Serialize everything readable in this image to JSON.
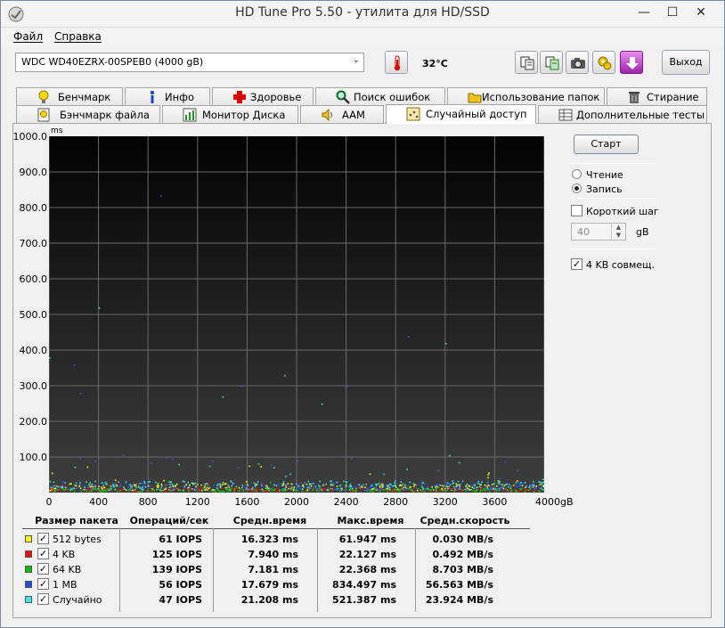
{
  "window": {
    "title": "HD Tune Pro 5.50 - утилита для HD/SSD"
  },
  "menu": [
    {
      "label": "Файл"
    },
    {
      "label": "Справка"
    }
  ],
  "toolbar": {
    "drive": "WDC WD40EZRX-00SPEB0 (4000 gB)",
    "temperature": "32°C",
    "exit_label": "Выход"
  },
  "tabs_top": [
    {
      "label": "Бенчмарк"
    },
    {
      "label": "Инфо"
    },
    {
      "label": "Здоровье"
    },
    {
      "label": "Поиск ошибок"
    },
    {
      "label": "Использование папок"
    },
    {
      "label": "Стирание"
    }
  ],
  "tabs_bottom": [
    {
      "label": "Бэнчмарк файла"
    },
    {
      "label": "Монитор Диска"
    },
    {
      "label": "AAM"
    },
    {
      "label": "Случайный доступ"
    },
    {
      "label": "Дополнительные  тесты"
    }
  ],
  "active_tab": "Случайный доступ",
  "chart": {
    "unit": "ms",
    "y_ticks": [
      "1000.0",
      "900.0",
      "800.0",
      "700.0",
      "600.0",
      "500.0",
      "400.0",
      "300.0",
      "200.0",
      "100.0"
    ],
    "x_ticks": [
      "0",
      "400",
      "800",
      "1200",
      "1600",
      "2000",
      "2400",
      "2800",
      "3200",
      "3600",
      "4000gB"
    ]
  },
  "chart_data": {
    "type": "scatter",
    "ylabel": "ms",
    "ylim": [
      0,
      1000
    ],
    "xlim": [
      0,
      4000
    ],
    "grid": true,
    "x_ticks": [
      0,
      400,
      800,
      1200,
      1600,
      2000,
      2400,
      2800,
      3200,
      3600,
      4000
    ],
    "series": [
      {
        "name": "512 bytes",
        "color": "#ffff00",
        "avg_ms": 16.323,
        "max_ms": 61.947
      },
      {
        "name": "4 KB",
        "color": "#ff0000",
        "avg_ms": 7.94,
        "max_ms": 22.127
      },
      {
        "name": "64 KB",
        "color": "#00cc00",
        "avg_ms": 7.181,
        "max_ms": 22.368
      },
      {
        "name": "1 MB",
        "color": "#2060ff",
        "avg_ms": 17.679,
        "max_ms": 834.497
      },
      {
        "name": "Случайно",
        "color": "#40e0e0",
        "avg_ms": 21.208,
        "max_ms": 521.387
      }
    ],
    "outliers": [
      {
        "x": 900,
        "y": 835
      },
      {
        "x": 400,
        "y": 520
      },
      {
        "x": 2900,
        "y": 440
      },
      {
        "x": 3200,
        "y": 420
      },
      {
        "x": 200,
        "y": 360
      },
      {
        "x": 1900,
        "y": 330
      },
      {
        "x": 2400,
        "y": 300
      },
      {
        "x": 0,
        "y": 380
      },
      {
        "x": 1550,
        "y": 300
      },
      {
        "x": 1400,
        "y": 270
      },
      {
        "x": 250,
        "y": 280
      },
      {
        "x": 2200,
        "y": 250
      }
    ]
  },
  "side": {
    "start_label": "Старт",
    "read_label": "Чтение",
    "write_label": "Запись",
    "short_step_label": "Короткий шаг",
    "step_value": "40",
    "step_unit": "gB",
    "align_label": "4 KB совмещ."
  },
  "table": {
    "headers": [
      "Размер пакета",
      "Операций/сек",
      "Средн.время",
      "Макс.время",
      "Средн.скорость"
    ],
    "rows": [
      {
        "name": "512 bytes",
        "color": "#ffff00",
        "iops": "61 IOPS",
        "avg": "16.323 ms",
        "max": "61.947 ms",
        "speed": "0.030 MB/s"
      },
      {
        "name": "4 KB",
        "color": "#ff0000",
        "iops": "125 IOPS",
        "avg": "7.940 ms",
        "max": "22.127 ms",
        "speed": "0.492 MB/s"
      },
      {
        "name": "64 KB",
        "color": "#00c000",
        "iops": "139 IOPS",
        "avg": "7.181 ms",
        "max": "22.368 ms",
        "speed": "8.703 MB/s"
      },
      {
        "name": "1 MB",
        "color": "#1a4fd8",
        "iops": "56 IOPS",
        "avg": "17.679 ms",
        "max": "834.497 ms",
        "speed": "56.563 MB/s"
      },
      {
        "name": "Случайно",
        "color": "#40e8e8",
        "iops": "47 IOPS",
        "avg": "21.208 ms",
        "max": "521.387 ms",
        "speed": "23.924 MB/s"
      }
    ]
  }
}
